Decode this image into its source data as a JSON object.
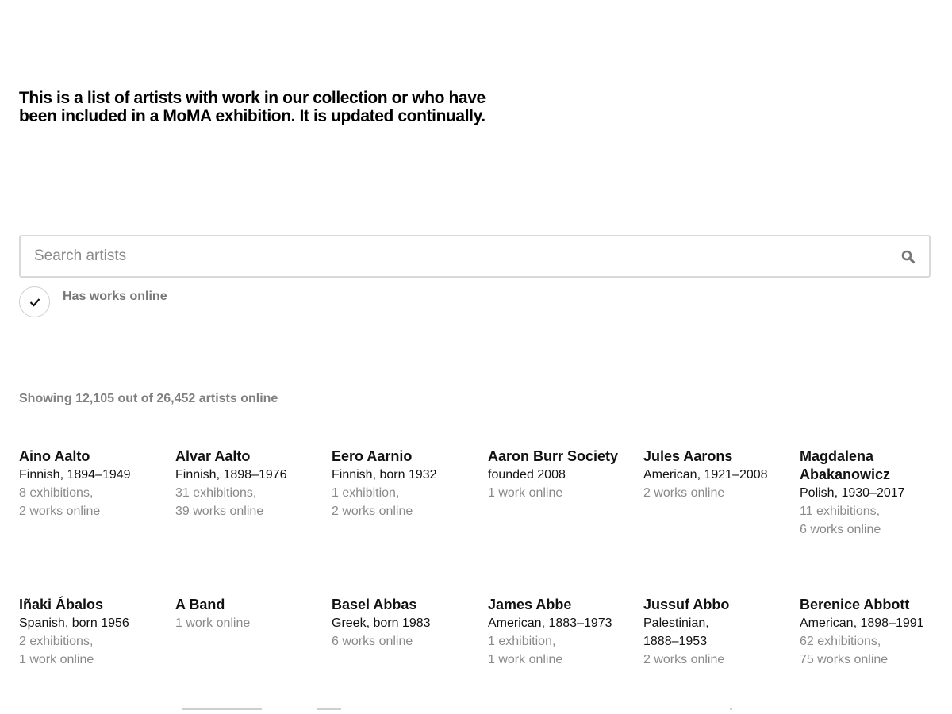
{
  "intro": {
    "line1": "This is a list of artists with work in our collection or who have",
    "line2": "been included in a MoMA exhibition. It is updated continually."
  },
  "search": {
    "placeholder": "Search artists",
    "icon": "search-icon"
  },
  "filter": {
    "label": "Has works online",
    "checked": true,
    "icon": "checkmark-icon"
  },
  "results": {
    "prefix": "Showing 12,105 out of",
    "link": "26,452 artists",
    "suffix": "online"
  },
  "artists": [
    {
      "name": "Aino Aalto",
      "bio": [
        "Finnish, 1894–1949"
      ],
      "exhibitions": "8 exhibitions,",
      "works": "2 works online"
    },
    {
      "name": "Alvar Aalto",
      "bio": [
        "Finnish, 1898–1976"
      ],
      "exhibitions": "31 exhibitions,",
      "works": "39 works online"
    },
    {
      "name": "Eero Aarnio",
      "bio": [
        "Finnish, born 1932"
      ],
      "exhibitions": "1 exhibition,",
      "works": "2 works online"
    },
    {
      "name": "Aaron Burr Society",
      "bio": [
        "founded 2008"
      ],
      "exhibitions": "",
      "works": "1 work online"
    },
    {
      "name": "Jules Aarons",
      "bio": [
        "American, 1921–2008"
      ],
      "exhibitions": "",
      "works": "2 works online"
    },
    {
      "name": "Magdalena Abakanowicz",
      "bio": [
        "Polish, 1930–2017"
      ],
      "exhibitions": "11 exhibitions,",
      "works": "6 works online"
    },
    {
      "name": "Iñaki Ábalos",
      "bio": [
        "Spanish, born 1956"
      ],
      "exhibitions": "2 exhibitions,",
      "works": "1 work online"
    },
    {
      "name": "A Band",
      "bio": [],
      "exhibitions": "",
      "works": "1 work online"
    },
    {
      "name": "Basel Abbas",
      "bio": [
        "Greek, born 1983"
      ],
      "exhibitions": "",
      "works": "6 works online"
    },
    {
      "name": "James Abbe",
      "bio": [
        "American, 1883–1973"
      ],
      "exhibitions": "1 exhibition,",
      "works": "1 work online"
    },
    {
      "name": "Jussuf Abbo",
      "bio": [
        "Palestinian,",
        "1888–1953"
      ],
      "exhibitions": "",
      "works": "2 works online"
    },
    {
      "name": "Berenice Abbott",
      "bio": [
        "American, 1898–1991"
      ],
      "exhibitions": "62 exhibitions,",
      "works": "75 works online"
    }
  ]
}
